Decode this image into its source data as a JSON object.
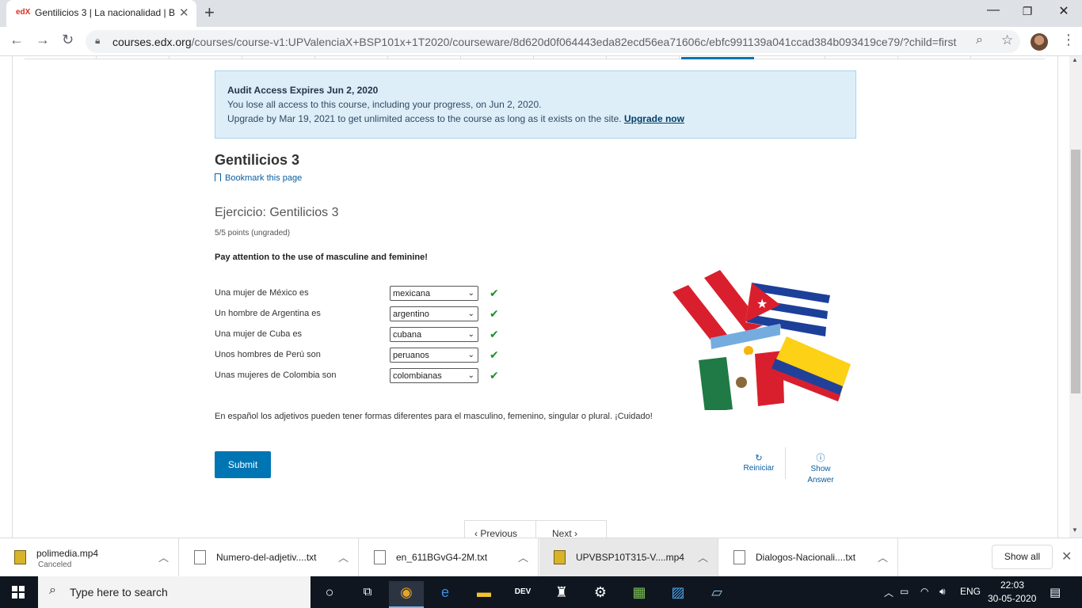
{
  "browser": {
    "tab_title": "Gentilicios 3 | La nacionalidad | B",
    "tab_favicon_text": "edX",
    "url_domain": "courses.edx.org",
    "url_path": "/courses/course-v1:UPValenciaX+BSP101x+1T2020/courseware/8d620d0f064443eda82ecd56ea71606c/ebfc991139a041ccad384b093419ce79/?child=first"
  },
  "banner": {
    "title": "Audit Access Expires Jun 2, 2020",
    "line1": "You lose all access to this course, including your progress, on Jun 2, 2020.",
    "line2": "Upgrade by Mar 19, 2021 to get unlimited access to the course as long as it exists on the site.",
    "upgrade_link": "Upgrade now"
  },
  "unit": {
    "title": "Gentilicios 3",
    "bookmark_label": "Bookmark this page"
  },
  "problem": {
    "title": "Ejercicio: Gentilicios 3",
    "points": "5/5 points (ungraded)",
    "instruction": "Pay attention to the use of masculine and feminine!",
    "questions": [
      {
        "label": "Una mujer de México es",
        "answer": "mexicana",
        "correct": true
      },
      {
        "label": "Un hombre de Argentina es",
        "answer": "argentino",
        "correct": true
      },
      {
        "label": "Una mujer de Cuba es",
        "answer": "cubana",
        "correct": true
      },
      {
        "label": "Unos hombres de Perú son",
        "answer": "peruanos",
        "correct": true
      },
      {
        "label": "Unas mujeres de Colombia son",
        "answer": "colombianas",
        "correct": true
      }
    ],
    "explanation": "En español los adjetivos pueden tener formas diferentes para el masculino, femenino, singular o plural. ¡Cuidado!",
    "submit_label": "Submit",
    "reset_label": "Reiniciar",
    "show_answer_label": "Show Answer"
  },
  "navigation": {
    "previous_label": "Previous",
    "next_label": "Next"
  },
  "downloads": {
    "items": [
      {
        "name": "polimedia.mp4",
        "status": "Canceled",
        "type": "media"
      },
      {
        "name": "Numero-del-adjetiv....txt",
        "status": "",
        "type": "text"
      },
      {
        "name": "en_611BGvG4-2M.txt",
        "status": "",
        "type": "text"
      },
      {
        "name": "UPVBSP10T315-V....mp4",
        "status": "",
        "type": "media"
      },
      {
        "name": "Dialogos-Nacionali....txt",
        "status": "",
        "type": "text"
      }
    ],
    "show_all_label": "Show all"
  },
  "taskbar": {
    "search_placeholder": "Type here to search",
    "language": "ENG",
    "time": "22:03",
    "date": "30-05-2020"
  },
  "colors": {
    "accent": "#0075b4",
    "banner_bg": "#deeef8",
    "check": "#1e8f2f"
  }
}
